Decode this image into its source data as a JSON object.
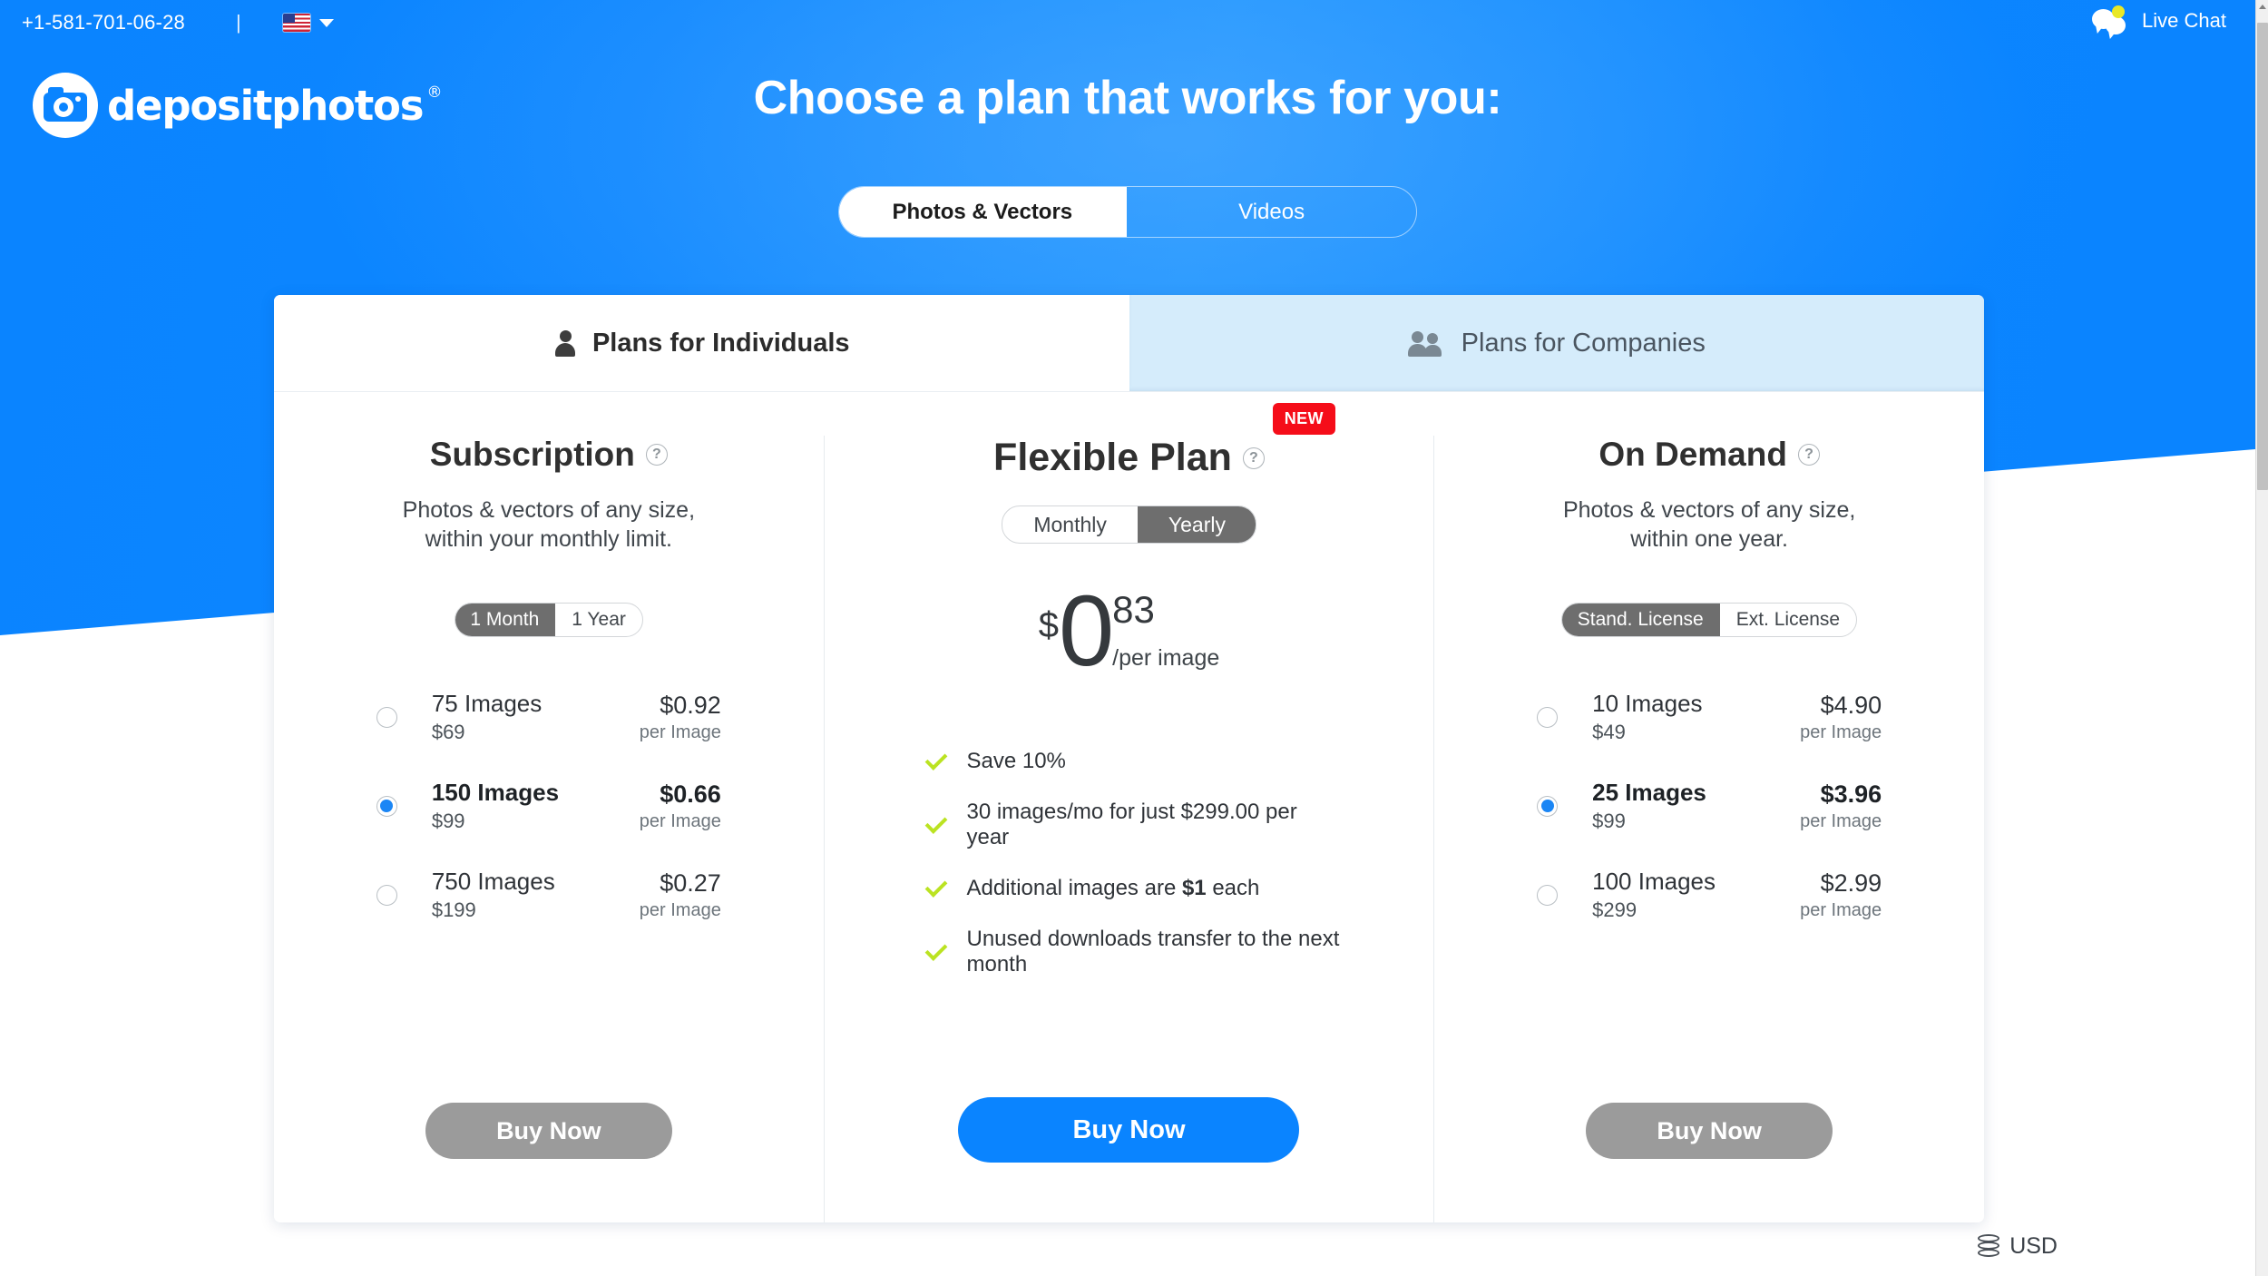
{
  "topbar": {
    "phone": "+1-581-701-06-28",
    "separator": "|",
    "flag_icon": "us-flag-icon",
    "lang_caret_icon": "chevron-down-icon",
    "live_chat_label": "Live Chat",
    "live_chat_icon": "chat-bubbles-icon"
  },
  "brand": {
    "name": "depositphotos",
    "registered_mark": "®",
    "logo_icon": "camera-circle-icon"
  },
  "hero": {
    "heading": "Choose a plan that works for you:",
    "accent_color": "#0a84ff"
  },
  "media_toggle": {
    "options": [
      {
        "label": "Photos & Vectors",
        "active": true
      },
      {
        "label": "Videos",
        "active": false
      }
    ]
  },
  "tabs": [
    {
      "label": "Plans for Individuals",
      "icon": "person-icon",
      "active": true
    },
    {
      "label": "Plans for Companies",
      "icon": "group-icon",
      "active": false
    }
  ],
  "plans": {
    "subscription": {
      "title": "Subscription",
      "help_icon": "question-circle-icon",
      "subtitle_line1": "Photos & vectors of any size,",
      "subtitle_line2": "within your monthly limit.",
      "period_toggle": [
        {
          "label": "1 Month",
          "active": true
        },
        {
          "label": "1 Year",
          "active": false
        }
      ],
      "options": [
        {
          "count": "75 Images",
          "total": "$69",
          "price": "$0.92",
          "per": "per Image",
          "selected": false
        },
        {
          "count": "150 Images",
          "total": "$99",
          "price": "$0.66",
          "per": "per Image",
          "selected": true
        },
        {
          "count": "750 Images",
          "total": "$199",
          "price": "$0.27",
          "per": "per Image",
          "selected": false
        }
      ],
      "buy_label": "Buy Now"
    },
    "flexible": {
      "title": "Flexible Plan",
      "help_icon": "question-circle-icon",
      "badge": "NEW",
      "badge_color": "#f50d19",
      "period_toggle": [
        {
          "label": "Monthly",
          "active": false
        },
        {
          "label": "Yearly",
          "active": true
        }
      ],
      "price": {
        "currency": "$",
        "whole": "0",
        "cents": "83",
        "per": "/per image"
      },
      "features": [
        {
          "text": "Save 10%",
          "bold_part": ""
        },
        {
          "text": "30 images/mo for just $299.00 per year",
          "bold_part": ""
        },
        {
          "text_pre": "Additional images are ",
          "bold_part": "$1",
          "text_post": " each"
        },
        {
          "text": "Unused downloads transfer to the next month",
          "bold_part": ""
        }
      ],
      "check_color": "#bbe322",
      "buy_label": "Buy Now",
      "buy_color": "#0a84ff"
    },
    "on_demand": {
      "title": "On Demand",
      "help_icon": "question-circle-icon",
      "subtitle_line1": "Photos & vectors of any size,",
      "subtitle_line2": "within one year.",
      "license_toggle": [
        {
          "label": "Stand. License",
          "active": true
        },
        {
          "label": "Ext. License",
          "active": false
        }
      ],
      "options": [
        {
          "count": "10 Images",
          "total": "$49",
          "price": "$4.90",
          "per": "per Image",
          "selected": false
        },
        {
          "count": "25 Images",
          "total": "$99",
          "price": "$3.96",
          "per": "per Image",
          "selected": true
        },
        {
          "count": "100 Images",
          "total": "$299",
          "price": "$2.99",
          "per": "per Image",
          "selected": false
        }
      ],
      "buy_label": "Buy Now"
    }
  },
  "footer": {
    "currency_label": "USD",
    "currency_icon": "coin-stack-icon"
  }
}
